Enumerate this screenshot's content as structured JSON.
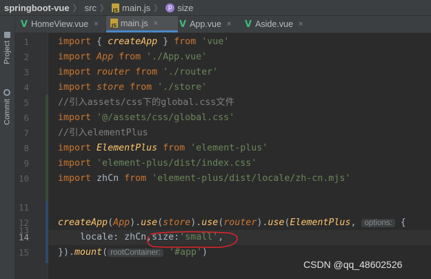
{
  "breadcrumb": {
    "project": "springboot-vue",
    "folder": "src",
    "file": "main.js",
    "symbol": "size",
    "file_icon_text": "JS",
    "symbol_icon_text": "p"
  },
  "tool_windows": [
    {
      "label": "Project"
    },
    {
      "label": "Commit"
    }
  ],
  "tabs": [
    {
      "label": "HomeView.vue",
      "icon": "vue-icon",
      "active": false
    },
    {
      "label": "main.js",
      "icon": "js-file-icon",
      "active": true
    },
    {
      "label": "App.vue",
      "icon": "vue-icon",
      "active": false
    },
    {
      "label": "Aside.vue",
      "icon": "vue-icon",
      "active": false
    }
  ],
  "tab_close_glyph": "×",
  "vue_glyph": "V",
  "line_numbers": [
    "1",
    "2",
    "3",
    "4",
    "5",
    "6",
    "7",
    "8",
    "9",
    "10",
    "11",
    "12",
    "13",
    "14",
    "15"
  ],
  "current_line": "14",
  "code": {
    "l1": {
      "kw": "import",
      "a": " { ",
      "name": "createApp",
      "b": " } ",
      "from": "from",
      "str": " 'vue'"
    },
    "l2": {
      "kw": "import",
      "name": " App ",
      "from": "from",
      "str": " './App.vue'"
    },
    "l3": {
      "kw": "import",
      "name": " router ",
      "from": "from",
      "str": " './router'"
    },
    "l4": {
      "kw": "import",
      "name": " store ",
      "from": "from",
      "str": " './store'"
    },
    "l5": {
      "comment": "//引入assets/css下的global.css文件"
    },
    "l6": {
      "kw": "import",
      "str": " '@/assets/css/global.css'"
    },
    "l7": {
      "comment": "//引入elementPlus"
    },
    "l8": {
      "kw": "import",
      "name": " ElementPlus ",
      "from": "from",
      "str": " 'element-plus'"
    },
    "l9": {
      "kw": "import",
      "str": " 'element-plus/dist/index.css'"
    },
    "l10": {
      "kw": "import",
      "name": " zhCn ",
      "from": "from",
      "str": " 'element-plus/dist/locale/zh-cn.mjs'"
    },
    "l13": {
      "fn": "createApp",
      "p1": "(",
      "app": "App",
      "p2": ").",
      "use1": "use",
      "p3": "(",
      "store": "store",
      "p4": ").",
      "use2": "use",
      "p5": "(",
      "router": "router",
      "p6": ").",
      "use3": "use",
      "p7": "(",
      "ep": "ElementPlus",
      "p8": ",",
      "hint": "options:",
      "p9": " {"
    },
    "l14": {
      "indent": "    ",
      "key": "locale",
      "colon": ": ",
      "val": "zhCn",
      "comma": ",",
      "size": "size",
      "colon2": ":",
      "str": "'small'",
      "comma2": ","
    },
    "l15": {
      "a": "}).",
      "fn": "mount",
      "b": "(",
      "hint": "rootContainer:",
      "str": " '#app'",
      "c": ")"
    }
  },
  "watermark": "CSDN @qq_48602526",
  "colors": {
    "keyword": "#cc7832",
    "string": "#6a8759",
    "comment": "#808080",
    "annotation": "#e0262b"
  }
}
